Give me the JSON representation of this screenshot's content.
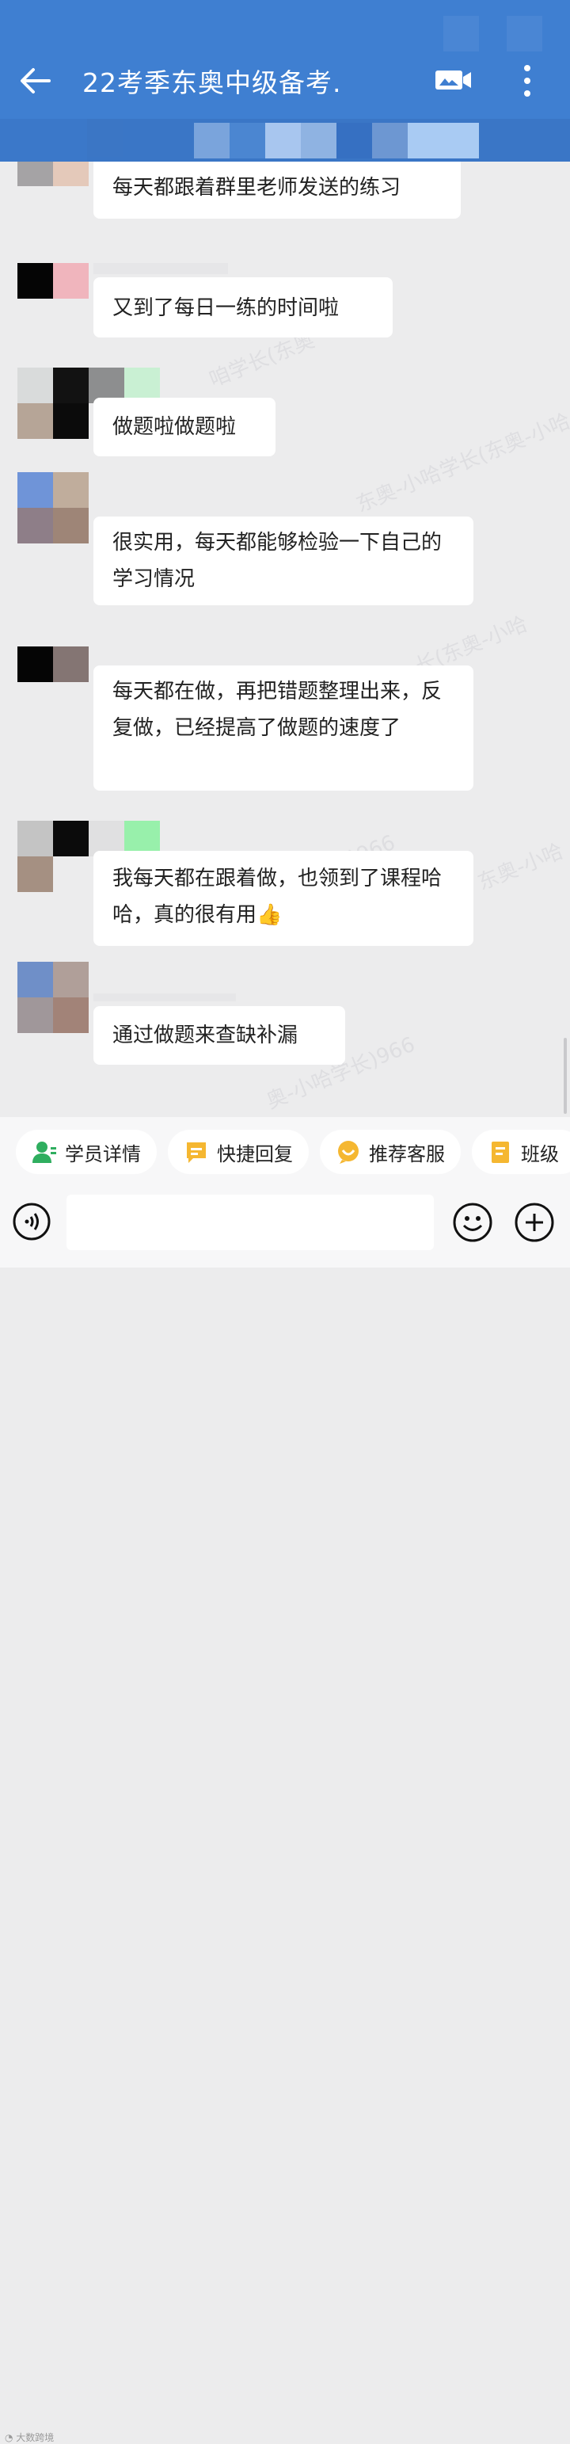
{
  "header": {
    "title": "22考季东奥中级备考.",
    "back_icon": "back-arrow-icon",
    "video_icon": "video-call-icon",
    "more_icon": "more-vertical-icon",
    "background": "#3f7fd1"
  },
  "messages": [
    {
      "text": "每天都跟着群里老师发送的练习"
    },
    {
      "text": "又到了每日一练的时间啦"
    },
    {
      "text": "做题啦做题啦"
    },
    {
      "text": "很实用，每天都能够检验一下自己的学习情况"
    },
    {
      "text": "每天都在做，再把错题整理出来，反复做，已经提高了做题的速度了"
    },
    {
      "text": "我每天都在跟着做，也领到了课程哈哈，真的很有用👍"
    },
    {
      "text": "通过做题来查缺补漏"
    }
  ],
  "quick_actions": [
    {
      "label": "学员详情",
      "icon": "student-info-icon",
      "color": "#2fae5f"
    },
    {
      "label": "快捷回复",
      "icon": "quick-reply-icon",
      "color": "#f5b731"
    },
    {
      "label": "推荐客服",
      "icon": "recommend-service-icon",
      "color": "#f5b731"
    },
    {
      "label": "班级",
      "icon": "class-icon",
      "color": "#f5b731"
    }
  ],
  "input_bar": {
    "voice_icon": "voice-icon",
    "emoji_icon": "emoji-icon",
    "plus_icon": "plus-icon",
    "placeholder": ""
  },
  "watermark": {
    "text1": "东奥-小哈学长(东奥-小哈学长)966",
    "footer": "大数跨境"
  }
}
